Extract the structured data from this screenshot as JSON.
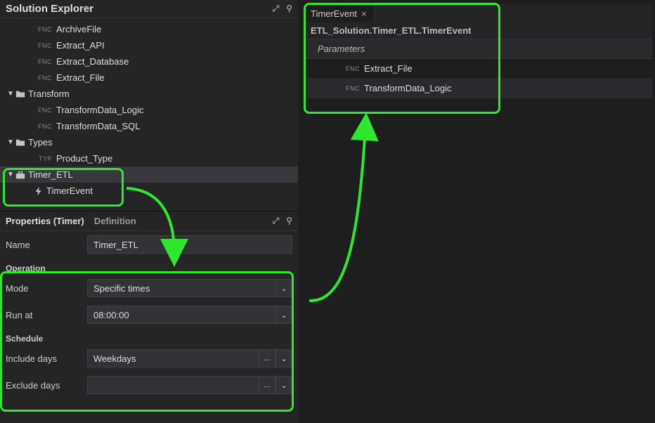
{
  "explorer": {
    "title": "Solution Explorer",
    "items": [
      {
        "badge": "FNC",
        "label": "ArchiveFile",
        "indent": 2
      },
      {
        "badge": "FNC",
        "label": "Extract_API",
        "indent": 2
      },
      {
        "badge": "FNC",
        "label": "Extract_Database",
        "indent": 2
      },
      {
        "badge": "FNC",
        "label": "Extract_File",
        "indent": 2
      },
      {
        "twist": "▼",
        "icon": "folder",
        "label": "Transform",
        "indent": 0
      },
      {
        "badge": "FNC",
        "label": "TransformData_Logic",
        "indent": 2
      },
      {
        "badge": "FNC",
        "label": "TransformData_SQL",
        "indent": 2
      },
      {
        "twist": "▼",
        "icon": "folder",
        "label": "Types",
        "indent": 0
      },
      {
        "badge": "TYP",
        "label": "Product_Type",
        "indent": 2
      },
      {
        "twist": "▼",
        "icon": "toolbox",
        "label": "Timer_ETL",
        "indent": 0,
        "selected": true
      },
      {
        "icon": "bolt",
        "label": "TimerEvent",
        "indent": 2
      }
    ]
  },
  "props": {
    "tab_active": "Properties (Timer)",
    "tab_inactive": "Definition",
    "name_label": "Name",
    "name_value": "Timer_ETL",
    "operation_label": "Operation",
    "mode_label": "Mode",
    "mode_value": "Specific times",
    "runat_label": "Run at",
    "runat_value": "08:00:00",
    "schedule_label": "Schedule",
    "include_label": "Include days",
    "include_value": "Weekdays",
    "exclude_label": "Exclude days",
    "exclude_value": ""
  },
  "editor": {
    "tab": "TimerEvent",
    "breadcrumb": "ETL_Solution.Timer_ETL.TimerEvent",
    "section": "Parameters",
    "params": [
      {
        "badge": "FNC",
        "label": "Extract_File"
      },
      {
        "badge": "FNC",
        "label": "TransformData_Logic"
      }
    ]
  },
  "glyphs": {
    "pin": "⚲",
    "maximize": "⤢",
    "chevron": "⌄",
    "ellipsis": "...",
    "close": "×"
  }
}
